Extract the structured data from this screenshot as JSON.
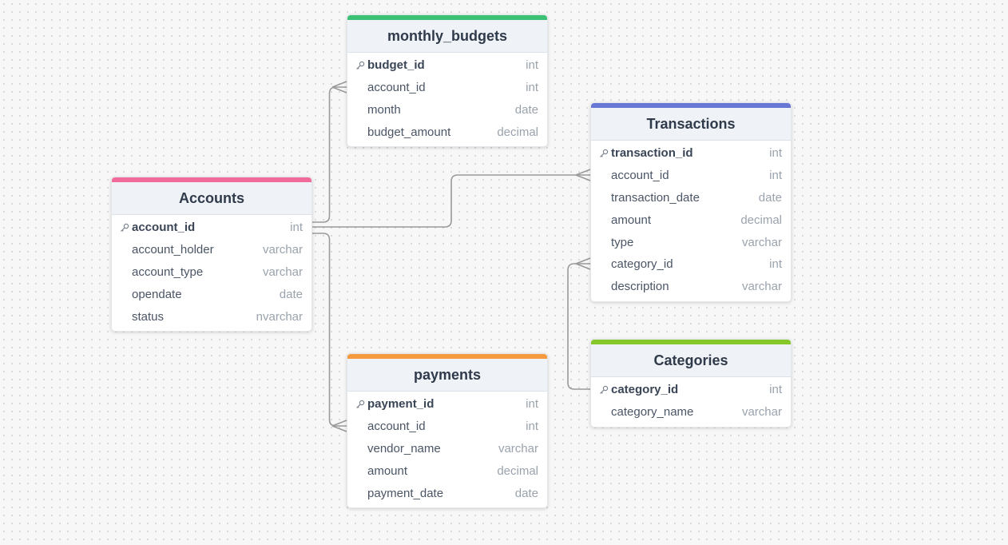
{
  "tables": {
    "monthly_budgets": {
      "name": "monthly_budgets",
      "color": "#3cc173",
      "fields": [
        {
          "name": "budget_id",
          "type": "int",
          "pk": true
        },
        {
          "name": "account_id",
          "type": "int"
        },
        {
          "name": "month",
          "type": "date"
        },
        {
          "name": "budget_amount",
          "type": "decimal"
        }
      ]
    },
    "transactions": {
      "name": "Transactions",
      "color": "#6877d3",
      "fields": [
        {
          "name": "transaction_id",
          "type": "int",
          "pk": true
        },
        {
          "name": "account_id",
          "type": "int"
        },
        {
          "name": "transaction_date",
          "type": "date"
        },
        {
          "name": "amount",
          "type": "decimal"
        },
        {
          "name": "type",
          "type": "varchar"
        },
        {
          "name": "category_id",
          "type": "int"
        },
        {
          "name": "description",
          "type": "varchar"
        }
      ]
    },
    "accounts": {
      "name": "Accounts",
      "color": "#f06b9a",
      "fields": [
        {
          "name": "account_id",
          "type": "int",
          "pk": true
        },
        {
          "name": "account_holder",
          "type": "varchar"
        },
        {
          "name": "account_type",
          "type": "varchar"
        },
        {
          "name": "opendate",
          "type": "date"
        },
        {
          "name": "status",
          "type": "nvarchar"
        }
      ]
    },
    "payments": {
      "name": "payments",
      "color": "#f59a3e",
      "fields": [
        {
          "name": "payment_id",
          "type": "int",
          "pk": true
        },
        {
          "name": "account_id",
          "type": "int"
        },
        {
          "name": "vendor_name",
          "type": "varchar"
        },
        {
          "name": "amount",
          "type": "decimal"
        },
        {
          "name": "payment_date",
          "type": "date"
        }
      ]
    },
    "categories": {
      "name": "Categories",
      "color": "#86c72a",
      "fields": [
        {
          "name": "category_id",
          "type": "int",
          "pk": true
        },
        {
          "name": "category_name",
          "type": "varchar"
        }
      ]
    }
  },
  "relationships": [
    {
      "from": "accounts.account_id",
      "to": "monthly_budgets.account_id",
      "cardinality": "one-to-many"
    },
    {
      "from": "accounts.account_id",
      "to": "transactions.account_id",
      "cardinality": "one-to-many"
    },
    {
      "from": "accounts.account_id",
      "to": "payments.account_id",
      "cardinality": "one-to-many"
    },
    {
      "from": "categories.category_id",
      "to": "transactions.category_id",
      "cardinality": "one-to-many"
    }
  ]
}
